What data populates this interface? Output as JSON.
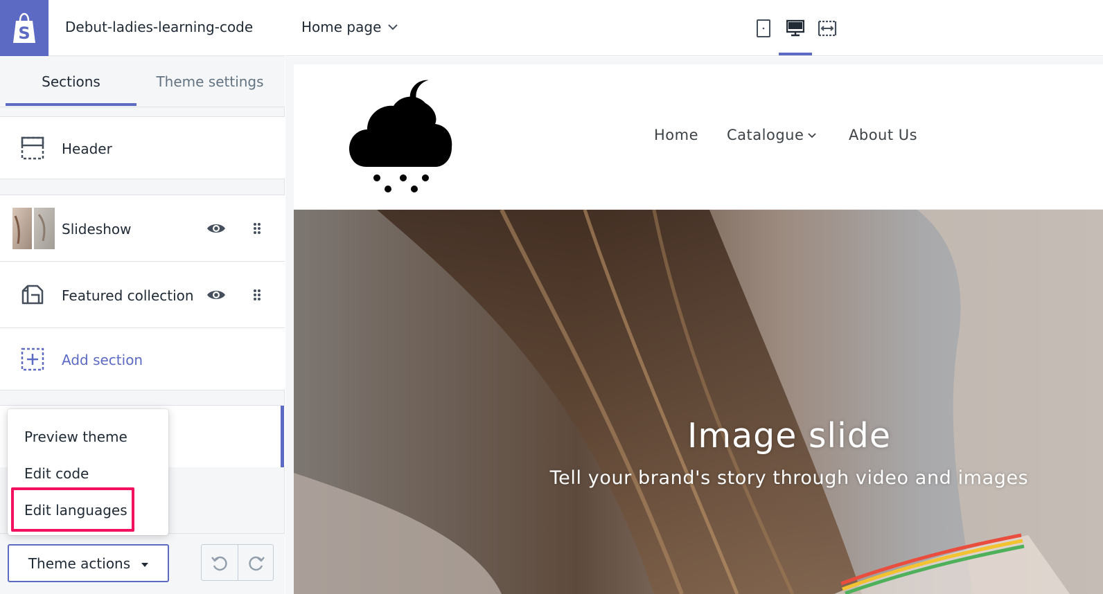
{
  "store": {
    "name": "Debut-ladies-learning-code"
  },
  "tabs": [
    {
      "label": "Sections"
    },
    {
      "label": "Theme settings"
    }
  ],
  "sections": {
    "header": {
      "label": "Header"
    },
    "slideshow": {
      "label": "Slideshow"
    },
    "featured": {
      "label": "Featured collection"
    },
    "add": {
      "label": "Add section"
    }
  },
  "theme_menu": {
    "items": [
      {
        "label": "Preview theme"
      },
      {
        "label": "Edit code"
      },
      {
        "label": "Edit languages",
        "highlighted": true
      }
    ]
  },
  "bottom": {
    "theme_actions_label": "Theme actions"
  },
  "toolbar": {
    "page_select": "Home page",
    "devices": [
      "mobile-icon",
      "desktop-icon",
      "fullwidth-icon"
    ],
    "active_device": "desktop"
  },
  "storefront": {
    "nav": [
      {
        "label": "Home"
      },
      {
        "label": "Catalogue"
      },
      {
        "label": "About Us"
      }
    ],
    "hero": {
      "title": "Image slide",
      "subtitle": "Tell your brand's story through video and images"
    }
  },
  "colors": {
    "accent": "#5c6ac4",
    "highlight": "#f3105e",
    "sidebar_bg": "#f4f6f8"
  }
}
